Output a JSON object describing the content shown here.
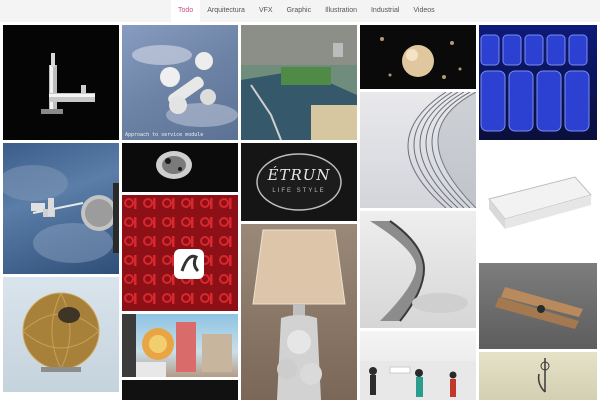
{
  "filters": [
    {
      "label": "Todo",
      "active": true
    },
    {
      "label": "Arquitectura",
      "active": false
    },
    {
      "label": "VFX",
      "active": false
    },
    {
      "label": "Graphic",
      "active": false
    },
    {
      "label": "Illustration",
      "active": false
    },
    {
      "label": "Industrial",
      "active": false
    },
    {
      "label": "Videos",
      "active": false
    }
  ],
  "colors": {
    "accent": "#d64f8a",
    "topbar": "#f4f4f4"
  },
  "gallery": {
    "space_station_caption": "Approach to service module",
    "logo_text": "ÉTRUN",
    "logo_subtext": "LIFE STYLE",
    "tiles": [
      {
        "subject": "faucet"
      },
      {
        "subject": "space-station-approach"
      },
      {
        "subject": "harbor-aerial"
      },
      {
        "subject": "splash-sculpture"
      },
      {
        "subject": "blue-glasses"
      },
      {
        "subject": "space-station-earth"
      },
      {
        "subject": "dark-object"
      },
      {
        "subject": "etrun-logo"
      },
      {
        "subject": "curved-architecture"
      },
      {
        "subject": "white-tray"
      },
      {
        "subject": "red-pattern"
      },
      {
        "subject": "lamp-sculpture"
      },
      {
        "subject": "hourglass-sculpture"
      },
      {
        "subject": "sphere-building"
      },
      {
        "subject": "urban-art"
      },
      {
        "subject": "clothespin"
      },
      {
        "subject": "interior-scene"
      },
      {
        "subject": "wire-sculpture"
      }
    ]
  }
}
